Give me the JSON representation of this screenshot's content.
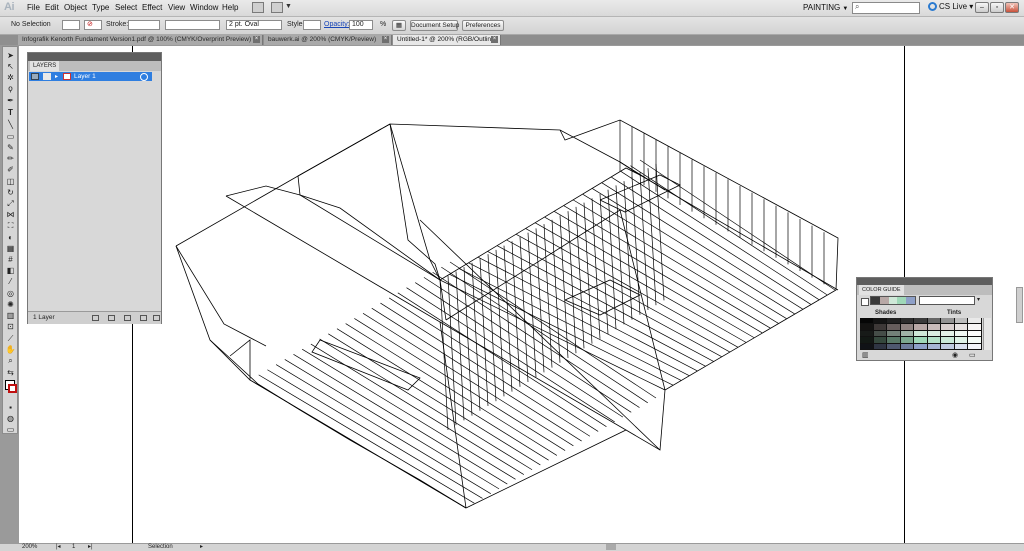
{
  "app": {
    "logo": "Ai"
  },
  "menu": [
    "File",
    "Edit",
    "Object",
    "Type",
    "Select",
    "Effect",
    "View",
    "Window",
    "Help"
  ],
  "workspace": {
    "label": "PAINTING",
    "arrow": "▼"
  },
  "search": {
    "placeholder": ""
  },
  "cslive": {
    "label": "CS Live ▾"
  },
  "control": {
    "selection": "No Selection",
    "stroke_label": "Stroke:",
    "brush_value": "2 pt. Oval",
    "style_label": "Style:",
    "opacity_label": "Opacity:",
    "opacity_value": "100",
    "percent": "%",
    "document_setup": "Document Setup",
    "preferences": "Preferences"
  },
  "tabs": [
    {
      "label": "Infografik Kenorth Fundament Version1.pdf @ 100% (CMYK/Overprint Preview)",
      "active": false
    },
    {
      "label": "bauwerk.ai @ 200% (CMYK/Preview)",
      "active": false
    },
    {
      "label": "Untitled-1* @ 200% (RGB/Outline)",
      "active": true
    }
  ],
  "layers": {
    "tab": "LAYERS",
    "items": [
      {
        "name": "Layer 1"
      }
    ],
    "count": "1 Layer"
  },
  "colorguide": {
    "tab": "COLOR GUIDE",
    "shades": "Shades",
    "tints": "Tints",
    "swatches": [
      "#3a3a3a",
      "#b8a8a6",
      "#cfe8d8",
      "#9fd8b8",
      "#8ea0c8"
    ],
    "colors": {
      "outline": "#000000",
      "selection": "#2f7ee0"
    }
  },
  "status": {
    "zoom": "200%",
    "page": "1",
    "tool": "Selection"
  }
}
